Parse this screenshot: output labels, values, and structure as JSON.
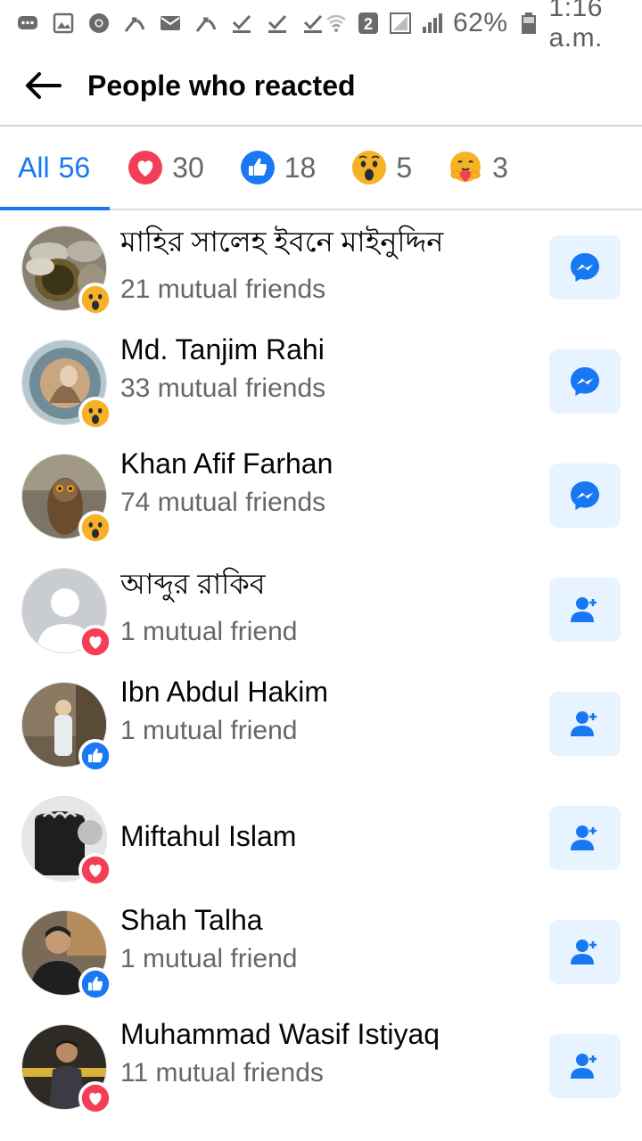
{
  "status_bar": {
    "battery": "62%",
    "time": "1:16 a.m.",
    "sim_indicator": "2"
  },
  "header": {
    "title": "People who reacted",
    "back_icon": "arrow-left-icon"
  },
  "tabs": [
    {
      "label": "All",
      "count": "56",
      "icon": "",
      "active": true
    },
    {
      "label": "",
      "count": "30",
      "icon": "love-reaction-icon",
      "active": false
    },
    {
      "label": "",
      "count": "18",
      "icon": "like-reaction-icon",
      "active": false
    },
    {
      "label": "",
      "count": "5",
      "icon": "wow-reaction-icon",
      "active": false
    },
    {
      "label": "",
      "count": "3",
      "icon": "care-reaction-icon",
      "active": false
    }
  ],
  "people": [
    {
      "name": "মাহির সালেহ ইবনে মাইনুদ্দিন",
      "mutual": "21 mutual friends",
      "reaction": "wow-reaction-icon",
      "action": "messenger-icon"
    },
    {
      "name": "Md. Tanjim Rahi",
      "mutual": "33 mutual friends",
      "reaction": "wow-reaction-icon",
      "action": "messenger-icon"
    },
    {
      "name": "Khan Afif Farhan",
      "mutual": "74 mutual friends",
      "reaction": "wow-reaction-icon",
      "action": "messenger-icon"
    },
    {
      "name": "আব্দুর রাকিব",
      "mutual": "1 mutual friend",
      "reaction": "love-reaction-icon",
      "action": "add-friend-icon"
    },
    {
      "name": "Ibn Abdul Hakim",
      "mutual": "1 mutual friend",
      "reaction": "like-reaction-icon",
      "action": "add-friend-icon"
    },
    {
      "name": "Miftahul Islam",
      "mutual": "",
      "reaction": "love-reaction-icon",
      "action": "add-friend-icon"
    },
    {
      "name": "Shah Talha",
      "mutual": "1 mutual friend",
      "reaction": "like-reaction-icon",
      "action": "add-friend-icon"
    },
    {
      "name": "Muhammad Wasif Istiyaq",
      "mutual": "11 mutual friends",
      "reaction": "love-reaction-icon",
      "action": "add-friend-icon"
    }
  ],
  "colors": {
    "accent": "#1877f2",
    "button_bg": "#e7f3ff",
    "secondary_text": "#65676b",
    "love": "#f33e58",
    "wow": "#f7b125"
  }
}
